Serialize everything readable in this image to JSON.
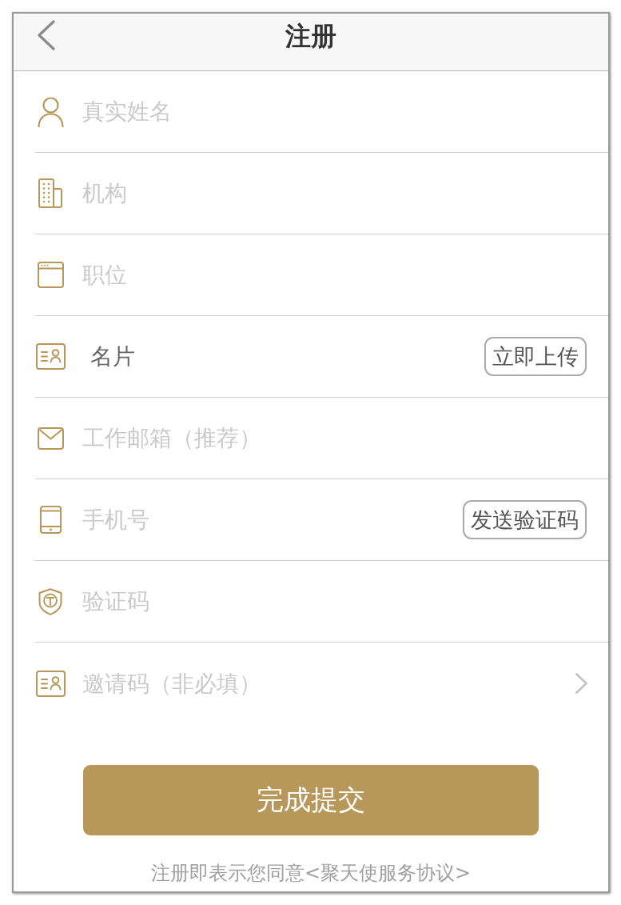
{
  "header": {
    "title": "注册"
  },
  "fields": [
    {
      "kind": "input",
      "placeholder": "真实姓名"
    },
    {
      "kind": "input",
      "placeholder": "机构"
    },
    {
      "kind": "input",
      "placeholder": "职位"
    },
    {
      "kind": "upload",
      "label": "名片",
      "button": "立即上传"
    },
    {
      "kind": "input",
      "placeholder": "工作邮箱（推荐）"
    },
    {
      "kind": "input",
      "placeholder": "手机号",
      "button": "发送验证码"
    },
    {
      "kind": "input",
      "placeholder": "验证码"
    },
    {
      "kind": "select",
      "placeholder": "邀请码（非必填）"
    }
  ],
  "submit_button": "完成提交",
  "agreement": "注册即表示您同意<聚天使服务协议>"
}
